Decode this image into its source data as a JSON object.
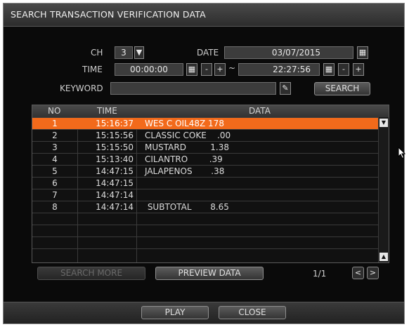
{
  "window": {
    "title": "SEARCH TRANSACTION VERIFICATION DATA"
  },
  "filters": {
    "ch_label": "CH",
    "ch_value": "3",
    "date_label": "DATE",
    "date_value": "03/07/2015",
    "time_label": "TIME",
    "time_from": "00:00:00",
    "time_sep": "~",
    "time_to": "22:27:56",
    "keyword_label": "KEYWORD",
    "keyword_value": "",
    "search_label": "SEARCH",
    "minus": "-",
    "plus": "+"
  },
  "table": {
    "headers": {
      "no": "NO",
      "time": "TIME",
      "data": "DATA"
    },
    "rows": [
      {
        "no": "1",
        "time": "15:16:37",
        "data": "WES C OIL48Z 178"
      },
      {
        "no": "2",
        "time": "15:15:56",
        "data": "CLASSIC COKE    .00"
      },
      {
        "no": "3",
        "time": "15:15:50",
        "data": "MUSTARD         1.38"
      },
      {
        "no": "4",
        "time": "15:13:40",
        "data": "CILANTRO        .39"
      },
      {
        "no": "5",
        "time": "14:47:15",
        "data": "JALAPENOS       .38"
      },
      {
        "no": "6",
        "time": "14:47:15",
        "data": ""
      },
      {
        "no": "7",
        "time": "14:47:14",
        "data": ""
      },
      {
        "no": "8",
        "time": "14:47:14",
        "data": " SUBTOTAL       8.65"
      }
    ]
  },
  "pager": {
    "search_more_label": "SEARCH MORE",
    "preview_label": "PREVIEW DATA",
    "page": "1/1",
    "prev": "<",
    "next": ">"
  },
  "footer": {
    "play_label": "PLAY",
    "close_label": "CLOSE"
  },
  "colors": {
    "selected_row": "#f26a1b",
    "background": "#0a0a0a"
  }
}
